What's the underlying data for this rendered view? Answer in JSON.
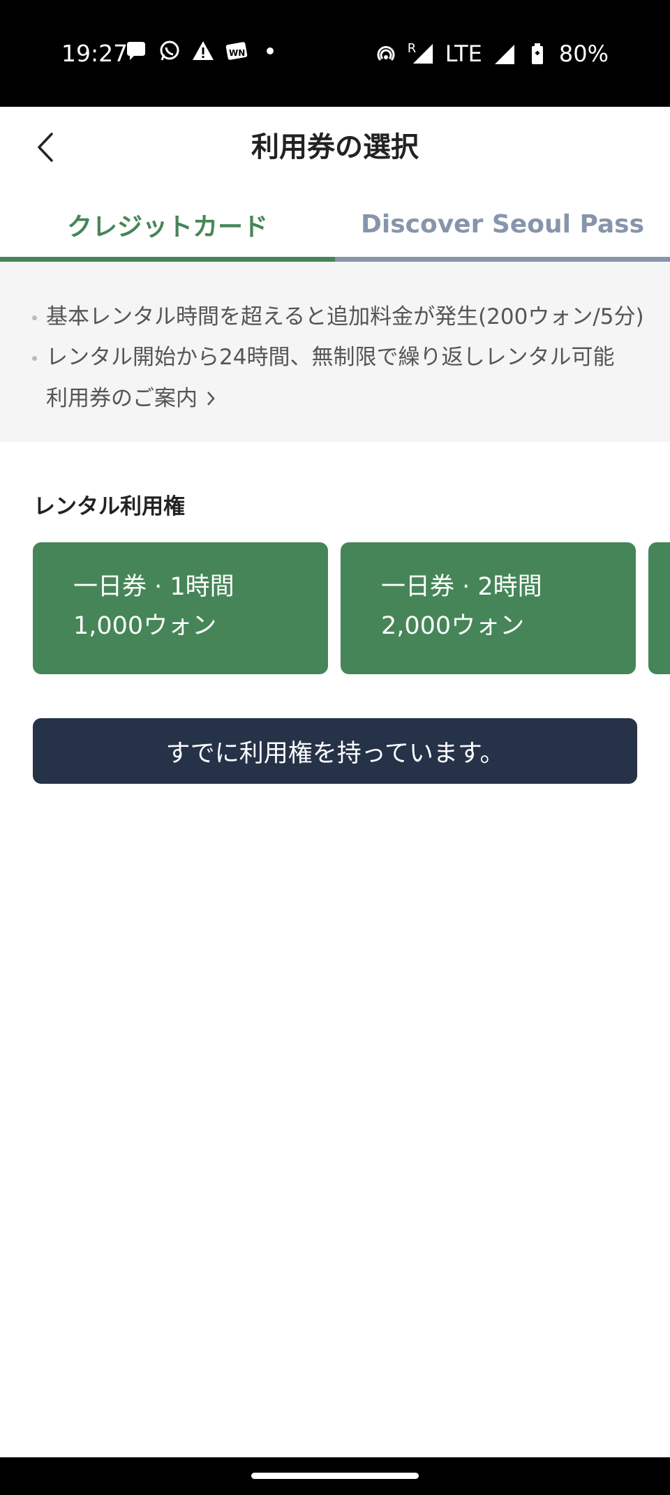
{
  "status_bar": {
    "time": "19:27",
    "roaming": "R",
    "network": "LTE",
    "battery": "80%",
    "icons": [
      "chat-bubble-icon",
      "whatsapp-icon",
      "warning-icon",
      "wn-app-icon",
      "dot-icon",
      "hotspot-icon",
      "signal-icon",
      "battery-saver-icon"
    ]
  },
  "header": {
    "title": "利用券の選択"
  },
  "tabs": [
    {
      "label": "クレジットカード",
      "active": true
    },
    {
      "label": "Discover Seoul Pass",
      "active": false
    }
  ],
  "info": {
    "bullets": [
      "基本レンタル時間を超えると追加料金が発生(200ウォン/5分)",
      "レンタル開始から24時間、無制限で繰り返しレンタル可能"
    ],
    "guide_link": "利用券のご案内"
  },
  "section": {
    "title": "レンタル利用権"
  },
  "cards": [
    {
      "title": "一日券 · 1時間",
      "price": "1,000ウォン"
    },
    {
      "title": "一日券 · 2時間",
      "price": "2,000ウォン"
    },
    {
      "title": "",
      "price": ""
    }
  ],
  "have_ticket_button": "すでに利用権を持っています。",
  "colors": {
    "accent_green": "#468557",
    "inactive_tab": "#8795ab",
    "button_navy": "#253248",
    "info_bg": "#f5f5f5"
  }
}
